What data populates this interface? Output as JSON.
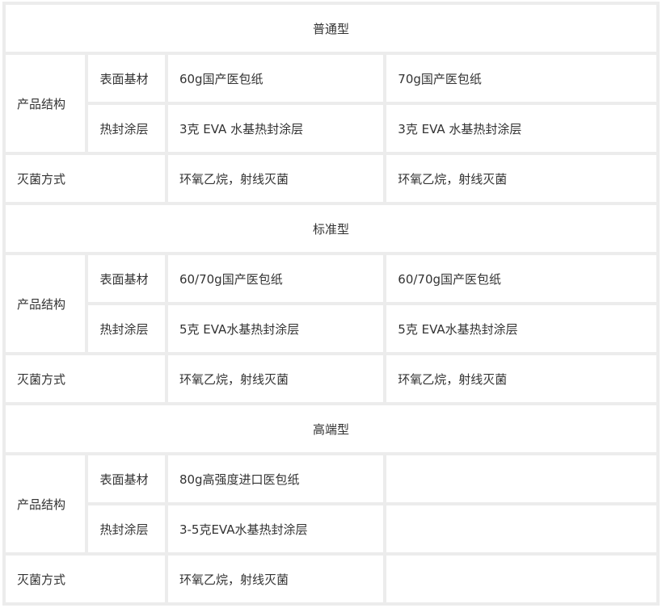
{
  "sections": [
    {
      "title": "普通型",
      "structure_label": "产品结构",
      "rows": [
        {
          "label": "表面基材",
          "col1": "60g国产医包纸",
          "col2": "70g国产医包纸"
        },
        {
          "label": "热封涂层",
          "col1": "3克 EVA 水基热封涂层",
          "col2": "3克 EVA 水基热封涂层"
        }
      ],
      "sterilization": {
        "label": "灭菌方式",
        "col1": "环氧乙烷，射线灭菌",
        "col2": "环氧乙烷，射线灭菌"
      }
    },
    {
      "title": "标准型",
      "structure_label": "产品结构",
      "rows": [
        {
          "label": "表面基材",
          "col1": "60/70g国产医包纸",
          "col2": "60/70g国产医包纸"
        },
        {
          "label": "热封涂层",
          "col1": "5克 EVA水基热封涂层",
          "col2": "5克 EVA水基热封涂层"
        }
      ],
      "sterilization": {
        "label": "灭菌方式",
        "col1": "环氧乙烷，射线灭菌",
        "col2": "环氧乙烷，射线灭菌"
      }
    },
    {
      "title": "高端型",
      "structure_label": "产品结构",
      "rows": [
        {
          "label": "表面基材",
          "col1": "80g高强度进口医包纸",
          "col2": ""
        },
        {
          "label": "热封涂层",
          "col1": "3-5克EVA水基热封涂层",
          "col2": ""
        }
      ],
      "sterilization": {
        "label": "灭菌方式",
        "col1": "环氧乙烷，射线灭菌",
        "col2": ""
      }
    }
  ]
}
